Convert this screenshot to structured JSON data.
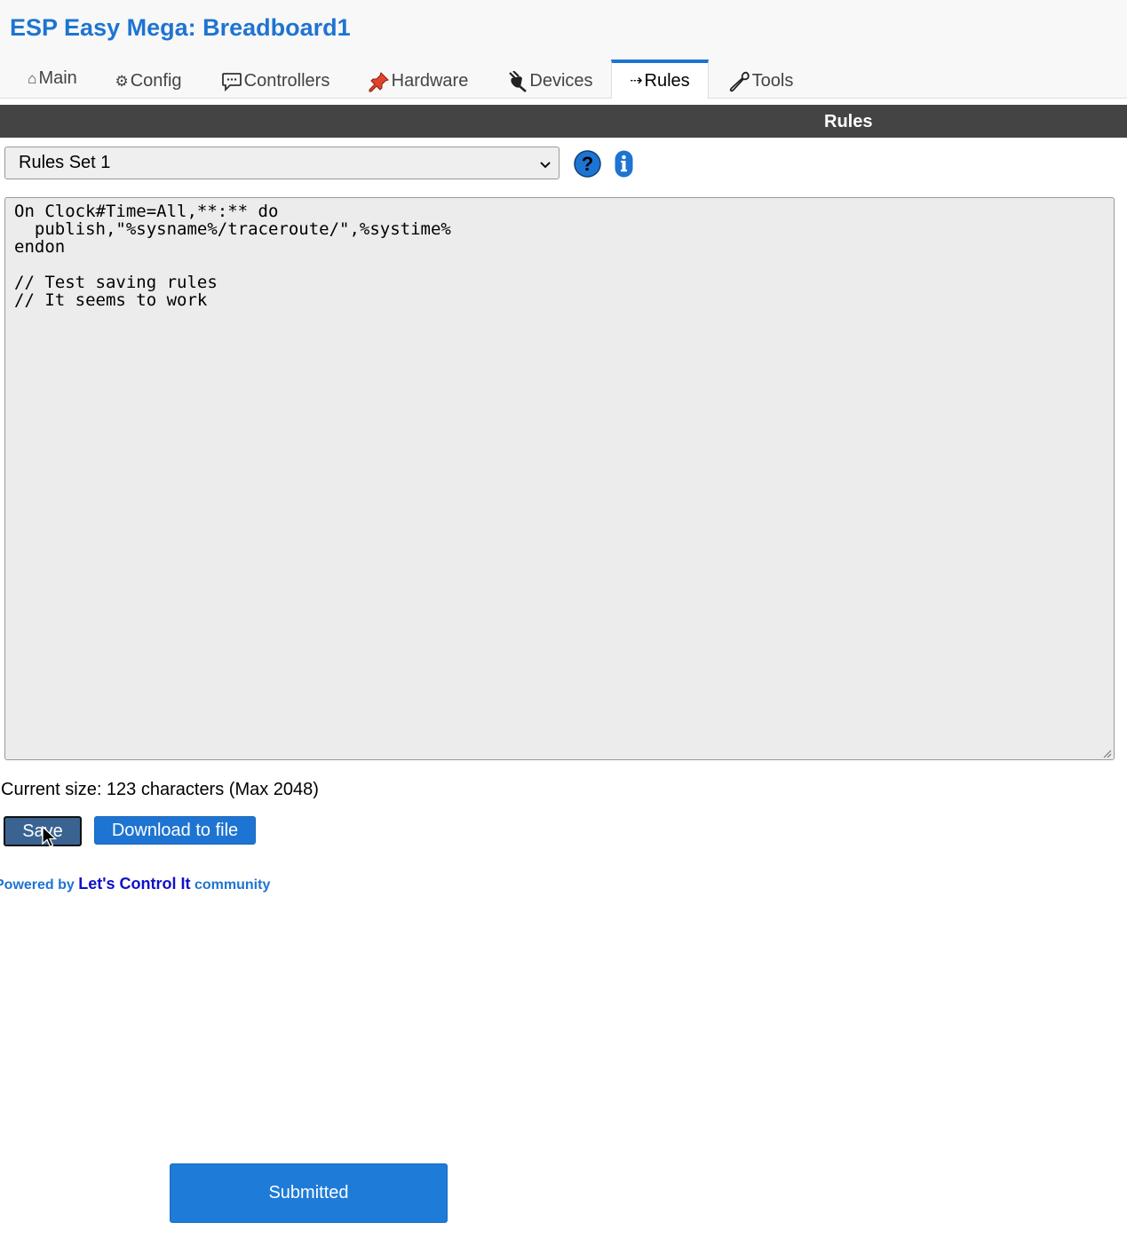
{
  "app": {
    "title": "ESP Easy Mega: Breadboard1"
  },
  "nav": {
    "tabs": [
      {
        "label": "Main",
        "icon": "home-icon",
        "glyph": "⌂",
        "active": false
      },
      {
        "label": "Config",
        "icon": "gear-icon",
        "glyph": "⚙",
        "active": false
      },
      {
        "label": "Controllers",
        "icon": "speech-bubble-icon",
        "glyph": "",
        "active": false
      },
      {
        "label": "Hardware",
        "icon": "pushpin-icon",
        "glyph": "",
        "active": false
      },
      {
        "label": "Devices",
        "icon": "plug-icon",
        "glyph": "",
        "active": false
      },
      {
        "label": "Rules",
        "icon": "arrow-icon",
        "glyph": "⇢",
        "active": true
      },
      {
        "label": "Tools",
        "icon": "wrench-icon",
        "glyph": "",
        "active": false
      }
    ]
  },
  "section": {
    "title": "Rules"
  },
  "rules_set": {
    "selected": "Rules Set 1"
  },
  "editor": {
    "content": "On Clock#Time=All,**:** do\n  publish,\"%sysname%/traceroute/\",%systime%\nendon\n\n// Test saving rules\n// It seems to work"
  },
  "size_info": "Current size: 123 characters (Max 2048)",
  "buttons": {
    "save": "Save",
    "download": "Download to file",
    "submitted": "Submitted"
  },
  "footer": {
    "prefix": "Powered by",
    "link": "Let's Control It",
    "suffix": "community"
  },
  "colors": {
    "accent": "#1e74d2",
    "section_bar": "#444444",
    "save_button": "#3a6391"
  }
}
